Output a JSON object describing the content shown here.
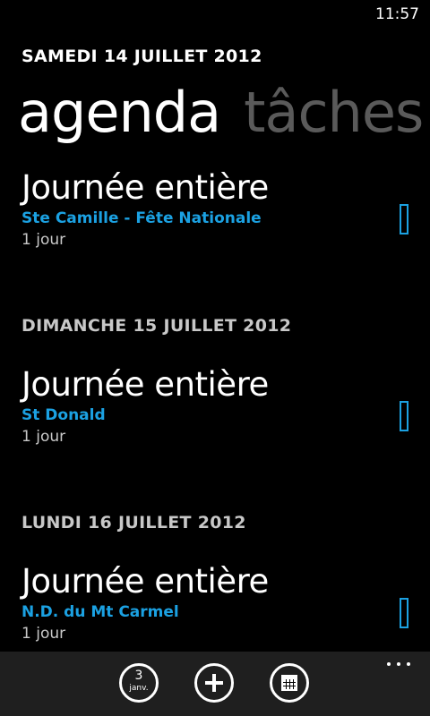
{
  "status": {
    "time": "11:57"
  },
  "header": {
    "date": "SAMEDI 14 JUILLET 2012"
  },
  "pivot": {
    "items": [
      "agenda",
      "tâches"
    ]
  },
  "days": [
    {
      "header": "",
      "event": {
        "title": "Journée entière",
        "subtitle": "Ste Camille - Fête Nationale",
        "duration": "1 jour"
      }
    },
    {
      "header": "DIMANCHE 15 JUILLET 2012",
      "event": {
        "title": "Journée entière",
        "subtitle": "St Donald",
        "duration": "1 jour"
      }
    },
    {
      "header": "LUNDI 16 JUILLET 2012",
      "event": {
        "title": "Journée entière",
        "subtitle": "N.D. du Mt Carmel",
        "duration": "1 jour"
      }
    }
  ],
  "app_bar": {
    "today_day": "3",
    "today_month": "janv.",
    "icons": [
      "today-icon",
      "add-icon",
      "month-view-icon",
      "more-icon"
    ]
  },
  "colors": {
    "accent": "#1ba1e2",
    "background": "#000000",
    "app_bar": "#1f1f1f",
    "inactive": "#5a5a5a"
  }
}
